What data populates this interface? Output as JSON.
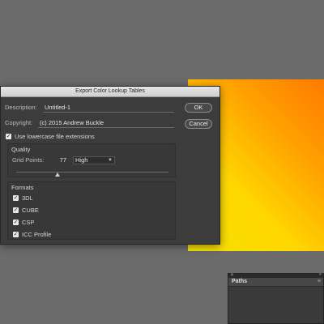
{
  "dialog": {
    "title": "Export Color Lookup Tables",
    "description_label": "Description:",
    "description_value": "Untitled-1",
    "copyright_label": "Copyright:",
    "copyright_value": "(c) 2015 Andrew Buckle",
    "lowercase_label": "Use lowercase file extensions",
    "lowercase_checked": true,
    "ok_label": "OK",
    "cancel_label": "Cancel",
    "quality": {
      "title": "Quality",
      "grid_points_label": "Grid Points:",
      "grid_points_value": "77",
      "quality_select": "High",
      "slider_fraction": 0.27
    },
    "formats": {
      "title": "Formats",
      "items": [
        {
          "label": "3DL",
          "checked": true
        },
        {
          "label": "CUBE",
          "checked": true
        },
        {
          "label": "CSP",
          "checked": true
        },
        {
          "label": "ICC Profile",
          "checked": true
        }
      ]
    }
  },
  "paths_panel": {
    "tab_label": "Paths",
    "close_glyph": "✕",
    "collapse_glyph": "»",
    "menu_glyph": "≡"
  },
  "colors": {
    "workspace": "#6b6b6b",
    "dialog_bg": "#3c3c3c",
    "gradient_orange": "#ff7a00",
    "gradient_yellow": "#ffd800"
  }
}
